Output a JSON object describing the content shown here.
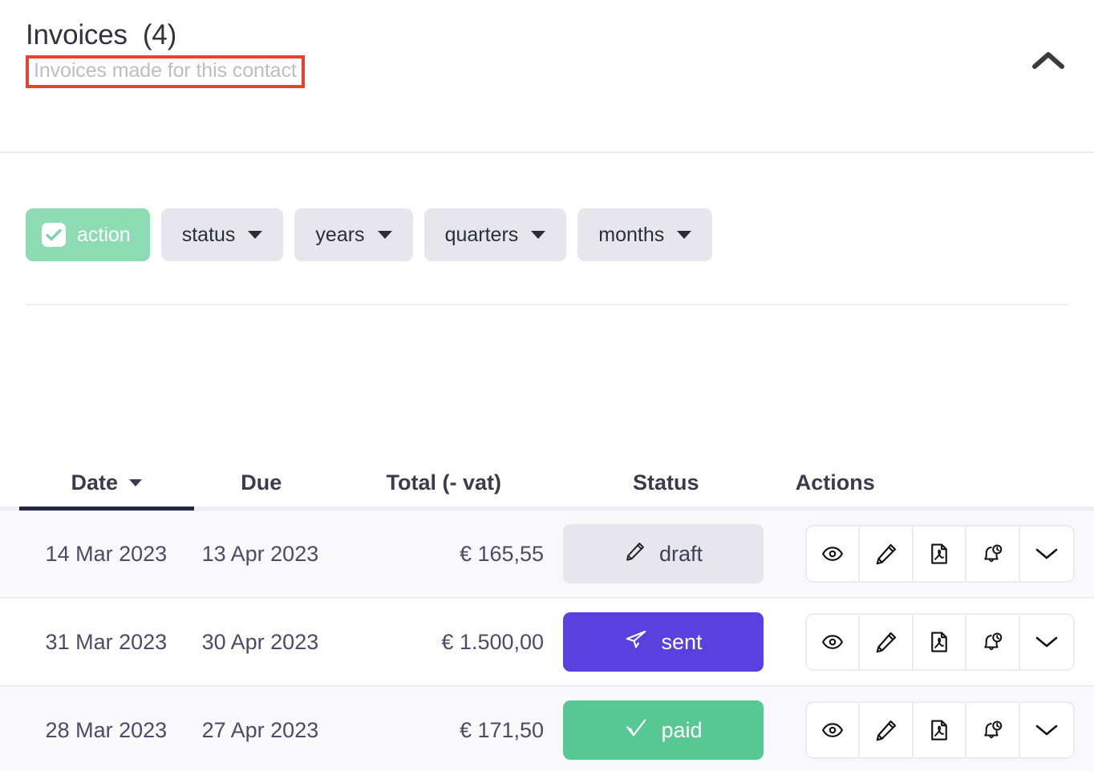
{
  "header": {
    "title": "Invoices  (4)",
    "subtitle": "Invoices made for this contact",
    "collapse_icon": "chevron-up-icon",
    "annotation_color": "#e8432a"
  },
  "filters": [
    {
      "label": "action",
      "icon": "checkbox-checked-icon",
      "active": true,
      "has_caret": false
    },
    {
      "label": "status",
      "icon": "chevron-down-icon",
      "active": false,
      "has_caret": true
    },
    {
      "label": "years",
      "icon": "chevron-down-icon",
      "active": false,
      "has_caret": true
    },
    {
      "label": "quarters",
      "icon": "chevron-down-icon",
      "active": false,
      "has_caret": true
    },
    {
      "label": "months",
      "icon": "chevron-down-icon",
      "active": false,
      "has_caret": true
    }
  ],
  "table": {
    "columns": [
      {
        "label": "Date",
        "sorted": true
      },
      {
        "label": "Due",
        "sorted": false
      },
      {
        "label": "Total (- vat)",
        "sorted": false
      },
      {
        "label": "Status",
        "sorted": false
      },
      {
        "label": "Actions",
        "sorted": false
      }
    ],
    "rows": [
      {
        "date": "14 Mar 2023",
        "due": "13 Apr 2023",
        "total": "€ 165,55",
        "status": {
          "label": "draft",
          "icon": "pencil-icon",
          "style": "draft"
        }
      },
      {
        "date": "31 Mar 2023",
        "due": "30 Apr 2023",
        "total": "€ 1.500,00",
        "status": {
          "label": "sent",
          "icon": "paper-plane-icon",
          "style": "sent"
        }
      },
      {
        "date": "28 Mar 2023",
        "due": "27 Apr 2023",
        "total": "€ 171,50",
        "status": {
          "label": "paid",
          "icon": "check-icon",
          "style": "paid"
        }
      }
    ],
    "row_actions": [
      "eye-icon",
      "pencil-icon",
      "pdf-file-icon",
      "bell-clock-icon",
      "chevron-down-icon"
    ]
  },
  "colors": {
    "accent_green": "#8ddcb4",
    "status_paid": "#57c793",
    "status_sent": "#5b40e0",
    "status_draft": "#e6e6ec",
    "text_dark": "#32323f",
    "text_row": "#4b4b68",
    "sort_underline": "#252444"
  }
}
